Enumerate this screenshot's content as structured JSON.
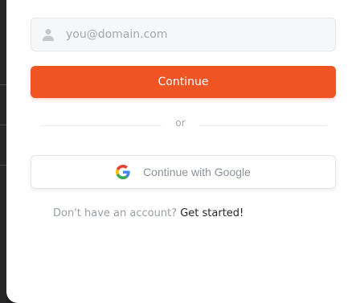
{
  "email": {
    "placeholder": "you@domain.com",
    "icon": "user-icon",
    "value": ""
  },
  "continue_button": {
    "label": "Continue",
    "color": "#f05423"
  },
  "divider": {
    "text": "or"
  },
  "google_button": {
    "label": "Continue with Google",
    "icon": "google-icon"
  },
  "signup": {
    "prompt": "Don't have an account?",
    "link_label": "Get started!"
  }
}
